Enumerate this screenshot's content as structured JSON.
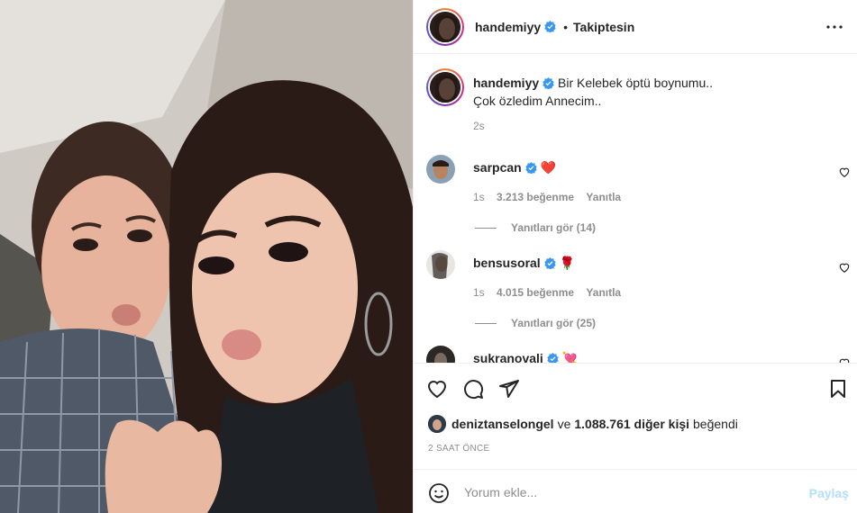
{
  "header": {
    "username": "handemiyy",
    "separator": "•",
    "follow_label": "Takiptesin",
    "more_icon": "more-horizontal-icon"
  },
  "caption": {
    "username": "handemiyy",
    "line1": "Bir Kelebek öptü boynumu..",
    "line2": "Çok özledim Annecim..",
    "time": "2s"
  },
  "comments": [
    {
      "username": "sarpcan",
      "text": "❤️",
      "time": "1s",
      "likes": "3.213 beğenme",
      "reply": "Yanıtla",
      "replies": "Yanıtları gör (14)"
    },
    {
      "username": "bensusoral",
      "text": "🌹",
      "time": "1s",
      "likes": "4.015 beğenme",
      "reply": "Yanıtla",
      "replies": "Yanıtları gör (25)"
    },
    {
      "username": "sukranovali",
      "text": "💘"
    }
  ],
  "likes": {
    "liker": "deniztanselongel",
    "connector": "ve",
    "others": "1.088.761 diğer kişi",
    "suffix": "beğendi"
  },
  "time_ago": "2 SAAT ÖNCE",
  "comment_box": {
    "placeholder": "Yorum ekle...",
    "post_label": "Paylaş"
  },
  "colors": {
    "verified": "#3897f0",
    "post_disabled": "#b2dffc",
    "muted": "#8e8e8e"
  }
}
